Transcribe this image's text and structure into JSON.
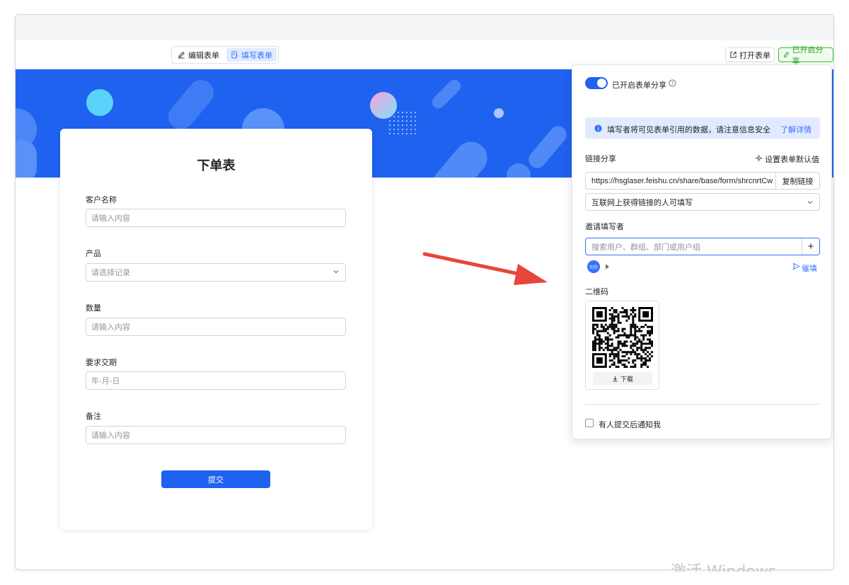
{
  "toolbar": {
    "edit_form": "编辑表单",
    "fill_form": "填写表单",
    "open_form": "打开表单",
    "share_enabled": "已开启分享",
    "accent_color": "#3370ff",
    "share_color": "#2ea121"
  },
  "form": {
    "title": "下单表",
    "fields": [
      {
        "label": "客户名称",
        "placeholder": "请输入内容"
      },
      {
        "label": "产品",
        "placeholder": "请选择记录"
      },
      {
        "label": "数量",
        "placeholder": "请输入内容"
      },
      {
        "label": "要求交期",
        "placeholder": "年-月-日"
      },
      {
        "label": "备注",
        "placeholder": "请输入内容"
      }
    ],
    "submit": "提交",
    "banner_color": "#1f62f0"
  },
  "share": {
    "toggle_label": "已开启表单分享",
    "toggle_on": true,
    "notice": "填写者将可见表单引用的数据，请注意信息安全",
    "learn_more": "了解详情",
    "link_share_title": "链接分享",
    "set_defaults": "设置表单默认值",
    "url": "https://hsglaser.feishu.cn/share/base/form/shrcnrtCw",
    "copy_link": "复制链接",
    "permission": "互联网上获得链接的人可填写",
    "invite_title": "邀请填写者",
    "invite_placeholder": "搜索用户、群组、部门或用户组",
    "add_symbol": "+",
    "remind": "催填",
    "avatar_text": "刘芬",
    "qr_title": "二维码",
    "download": "下载",
    "notify_label": "有人提交后通知我",
    "notify_checked": false
  },
  "watermark": "激活 Windows"
}
